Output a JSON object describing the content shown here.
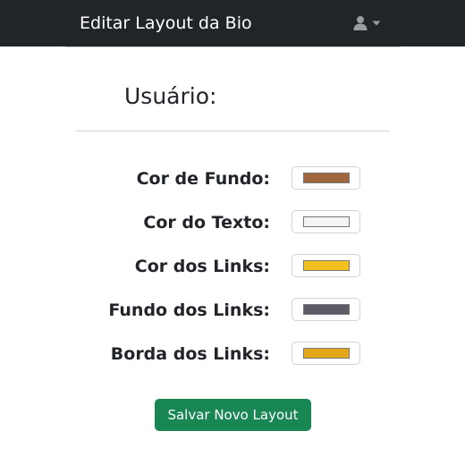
{
  "navbar": {
    "brand": "Editar Layout da Bio",
    "user_icon": "user-icon",
    "caret_icon": "caret-down-icon"
  },
  "page": {
    "title": "Usuário:"
  },
  "fields": [
    {
      "label": "Cor de Fundo:",
      "color": "#a0673f"
    },
    {
      "label": "Cor do Texto:",
      "color": "#f5f4f2"
    },
    {
      "label": "Cor dos Links:",
      "color": "#f3c11e"
    },
    {
      "label": "Fundo dos Links:",
      "color": "#5c5b66"
    },
    {
      "label": "Borda dos Links:",
      "color": "#e4a71a"
    }
  ],
  "actions": {
    "save_label": "Salvar Novo Layout"
  },
  "colors": {
    "navbar_bg": "#212529",
    "save_button_bg": "#198754"
  }
}
